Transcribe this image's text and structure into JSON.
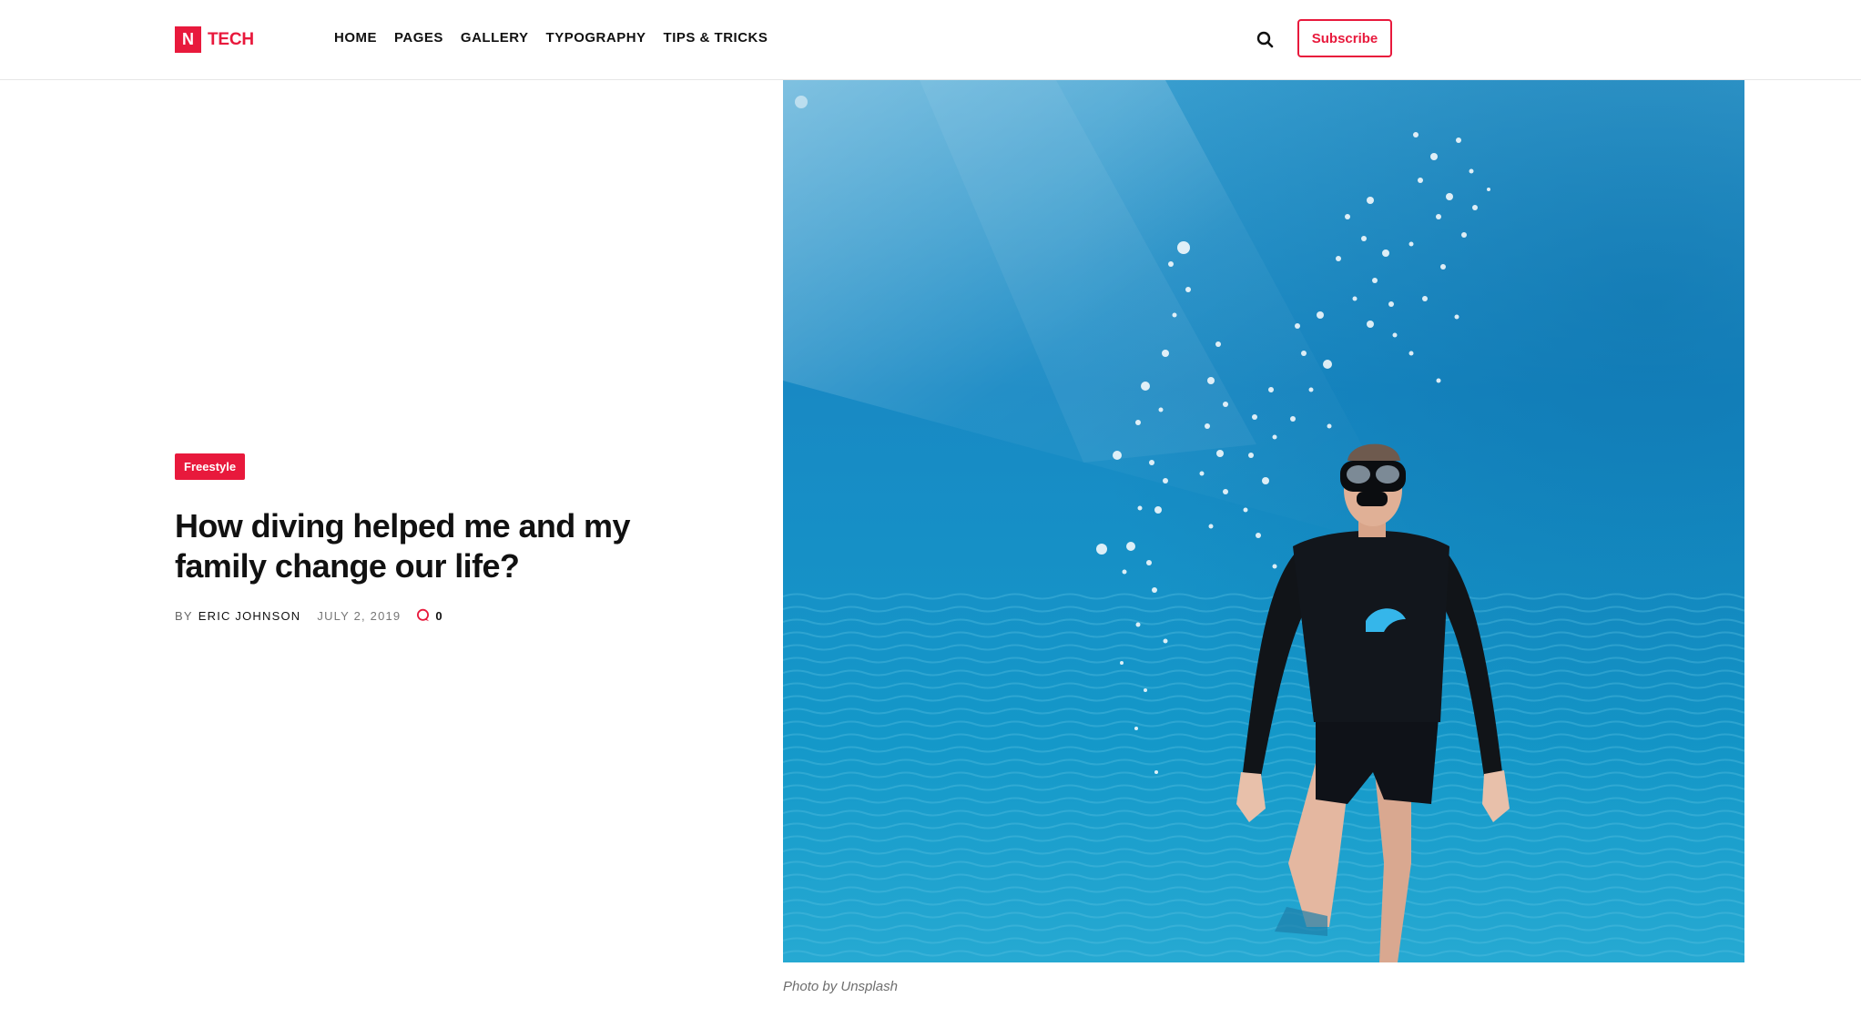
{
  "brand": {
    "logo_letter": "N",
    "name": "TECH",
    "accent_color": "#e8193c"
  },
  "nav": {
    "items": [
      {
        "label": "HOME"
      },
      {
        "label": "PAGES"
      },
      {
        "label": "GALLERY"
      },
      {
        "label": "TYPOGRAPHY"
      },
      {
        "label": "TIPS & TRICKS"
      }
    ]
  },
  "header": {
    "search_icon": "search-icon",
    "subscribe_label": "Subscribe"
  },
  "article": {
    "category": "Freestyle",
    "title": "How diving helped me and my family change our life?",
    "meta": {
      "by": "BY",
      "author": "ERIC JOHNSON",
      "date": "JULY 2, 2019",
      "comments_icon": "comment-icon",
      "comments_count": "0"
    },
    "image": {
      "subject": "underwater-diver-photo",
      "caption": "Photo by Unsplash"
    }
  }
}
